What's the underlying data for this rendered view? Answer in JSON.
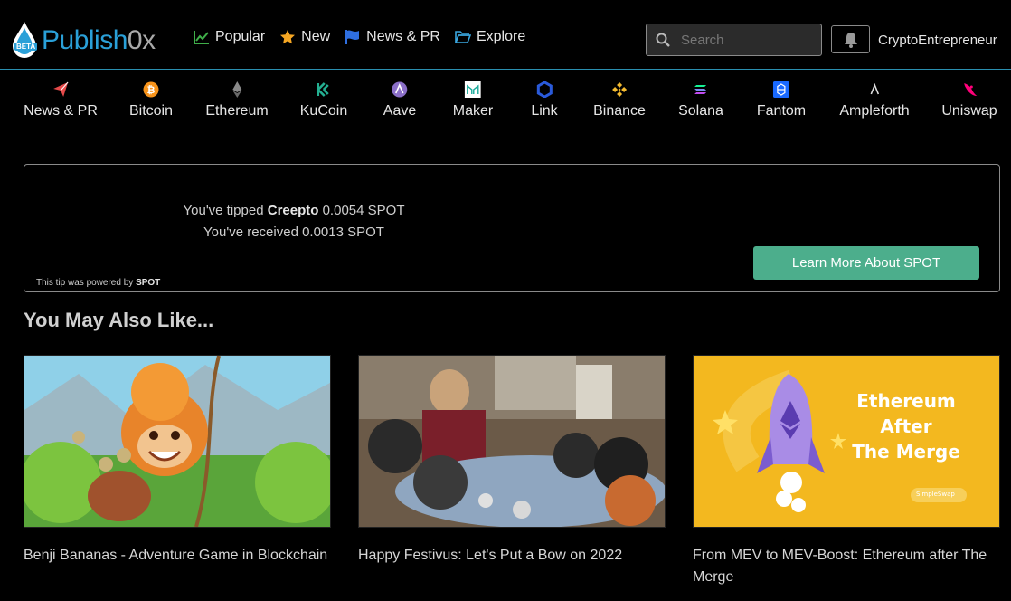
{
  "header": {
    "logo_main": "Publish",
    "logo_suffix": "0x",
    "logo_badge": "BETA",
    "nav": [
      {
        "label": "Popular",
        "icon": "chart-line-icon"
      },
      {
        "label": "New",
        "icon": "star-icon"
      },
      {
        "label": "News & PR",
        "icon": "flag-icon"
      },
      {
        "label": "Explore",
        "icon": "folder-open-icon"
      }
    ],
    "search_placeholder": "Search",
    "username": "CryptoEntrepreneur"
  },
  "categories": [
    {
      "label": "News & PR",
      "icon": "paper-plane-icon",
      "color": "#e64a4a"
    },
    {
      "label": "Bitcoin",
      "icon": "bitcoin-icon",
      "color": "#f7931a"
    },
    {
      "label": "Ethereum",
      "icon": "ethereum-icon",
      "color": "#9a9a9a"
    },
    {
      "label": "KuCoin",
      "icon": "kucoin-icon",
      "color": "#23af91"
    },
    {
      "label": "Aave",
      "icon": "aave-icon",
      "color": "#b6509e"
    },
    {
      "label": "Maker",
      "icon": "maker-icon",
      "color": "#1aab9b"
    },
    {
      "label": "Link",
      "icon": "chainlink-icon",
      "color": "#2a5ada"
    },
    {
      "label": "Binance",
      "icon": "binance-icon",
      "color": "#f3ba2f"
    },
    {
      "label": "Solana",
      "icon": "solana-icon",
      "color": "#14f195"
    },
    {
      "label": "Fantom",
      "icon": "fantom-icon",
      "color": "#1969ff"
    },
    {
      "label": "Ampleforth",
      "icon": "ampleforth-icon",
      "color": "#e0e0e0"
    },
    {
      "label": "Uniswap",
      "icon": "uniswap-icon",
      "color": "#ff007a"
    }
  ],
  "tip": {
    "tipped_prefix": "You've tipped ",
    "tipped_user": "Creepto",
    "tipped_amount": " 0.0054 SPOT",
    "received": "You've received 0.0013 SPOT",
    "powered_prefix": "This tip was powered by ",
    "powered_brand": "SPOT",
    "button": "Learn More About SPOT"
  },
  "related": {
    "title": "You May Also Like...",
    "cards": [
      {
        "title": "Benji Bananas - Adventure Game in Blockchain"
      },
      {
        "title": "Happy Festivus: Let's Put a Bow on 2022"
      },
      {
        "title": "From MEV to MEV-Boost: Ethereum after The Merge",
        "image_text_1": "Ethereum After",
        "image_text_2": "The Merge",
        "image_badge": "SimpleSwap"
      }
    ]
  },
  "colors": {
    "accent": "#2aa0d8",
    "button": "#4cae8c",
    "background": "#000000"
  }
}
